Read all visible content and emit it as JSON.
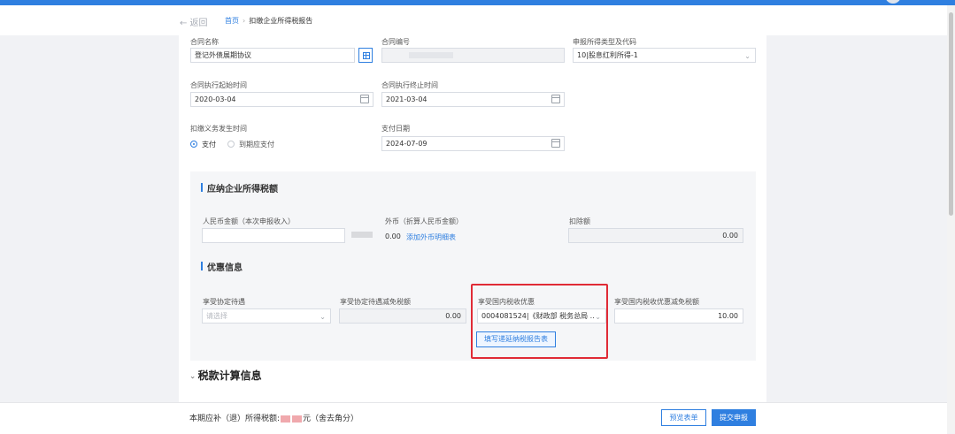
{
  "nav": {
    "back": "← 返回",
    "home": "首页",
    "separator": "›",
    "current": "扣缴企业所得税报告"
  },
  "contract": {
    "name_label": "合同名称",
    "name_value": "登记外债展期协议",
    "no_label": "合同编号",
    "type_label": "申报所得类型及代码",
    "type_value": "10|股息红利所得-1",
    "start_label": "合同执行起始时间",
    "start_value": "2020-03-04",
    "end_label": "合同执行终止时间",
    "end_value": "2021-03-04",
    "obligation_label": "扣缴义务发生时间",
    "radio_pay": "支付",
    "radio_due": "到期应支付",
    "paydate_label": "支付日期",
    "paydate_value": "2024-07-09"
  },
  "taxable": {
    "title": "应纳企业所得税额",
    "rmb_label": "人民币金额（本次申报收入）",
    "foreign_label": "外币（折算人民币金额）",
    "foreign_value": "0.00",
    "foreign_link": "添加外币明细表",
    "deduct_label": "扣除额",
    "deduct_value": "0.00"
  },
  "discount": {
    "title": "优惠信息",
    "treaty_label": "享受协定待遇",
    "treaty_placeholder": "请选择",
    "treaty_reduce_label": "享受协定待遇减免税额",
    "treaty_reduce_value": "0.00",
    "domestic_label": "享受国内税收优惠",
    "domestic_value": "0004081524|《财政部 税务总局 ...",
    "domestic_reduce_label": "享受国内税收优惠减免税额",
    "domestic_reduce_value": "10.00",
    "fill_button": "填写递延纳税报告表"
  },
  "calc": {
    "arrow": "›",
    "title": "税款计算信息"
  },
  "footer": {
    "label": "本期应补（退）所得税额:",
    "unit": "元（舍去角分）",
    "preview": "预览表单",
    "submit": "提交申报"
  }
}
